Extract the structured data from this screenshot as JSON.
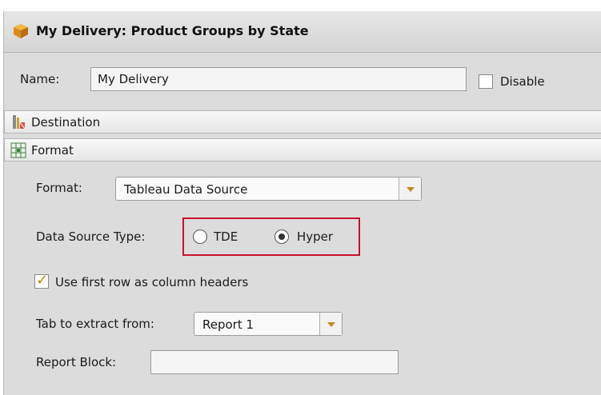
{
  "dialog": {
    "title": "My Delivery: Product Groups by State",
    "title_icon": "box-icon"
  },
  "name_row": {
    "label": "Name:",
    "value": "My Delivery",
    "disable_label": "Disable",
    "disable_checked": false
  },
  "sections": {
    "destination": {
      "label": "Destination",
      "icon": "destination-icon"
    },
    "format": {
      "label": "Format",
      "icon": "format-icon"
    }
  },
  "format_panel": {
    "format_label": "Format:",
    "format_value": "Tableau Data Source",
    "data_source_type_label": "Data Source Type:",
    "options": [
      {
        "label": "TDE",
        "selected": false
      },
      {
        "label": "Hyper",
        "selected": true
      }
    ],
    "first_row_headers_label": "Use first row as column headers",
    "first_row_headers_checked": true,
    "tab_label": "Tab to extract from:",
    "tab_value": "Report 1",
    "report_block_label": "Report Block:",
    "report_block_value": ""
  },
  "colors": {
    "highlight": "#c8102e",
    "accent": "#c08a1f"
  }
}
